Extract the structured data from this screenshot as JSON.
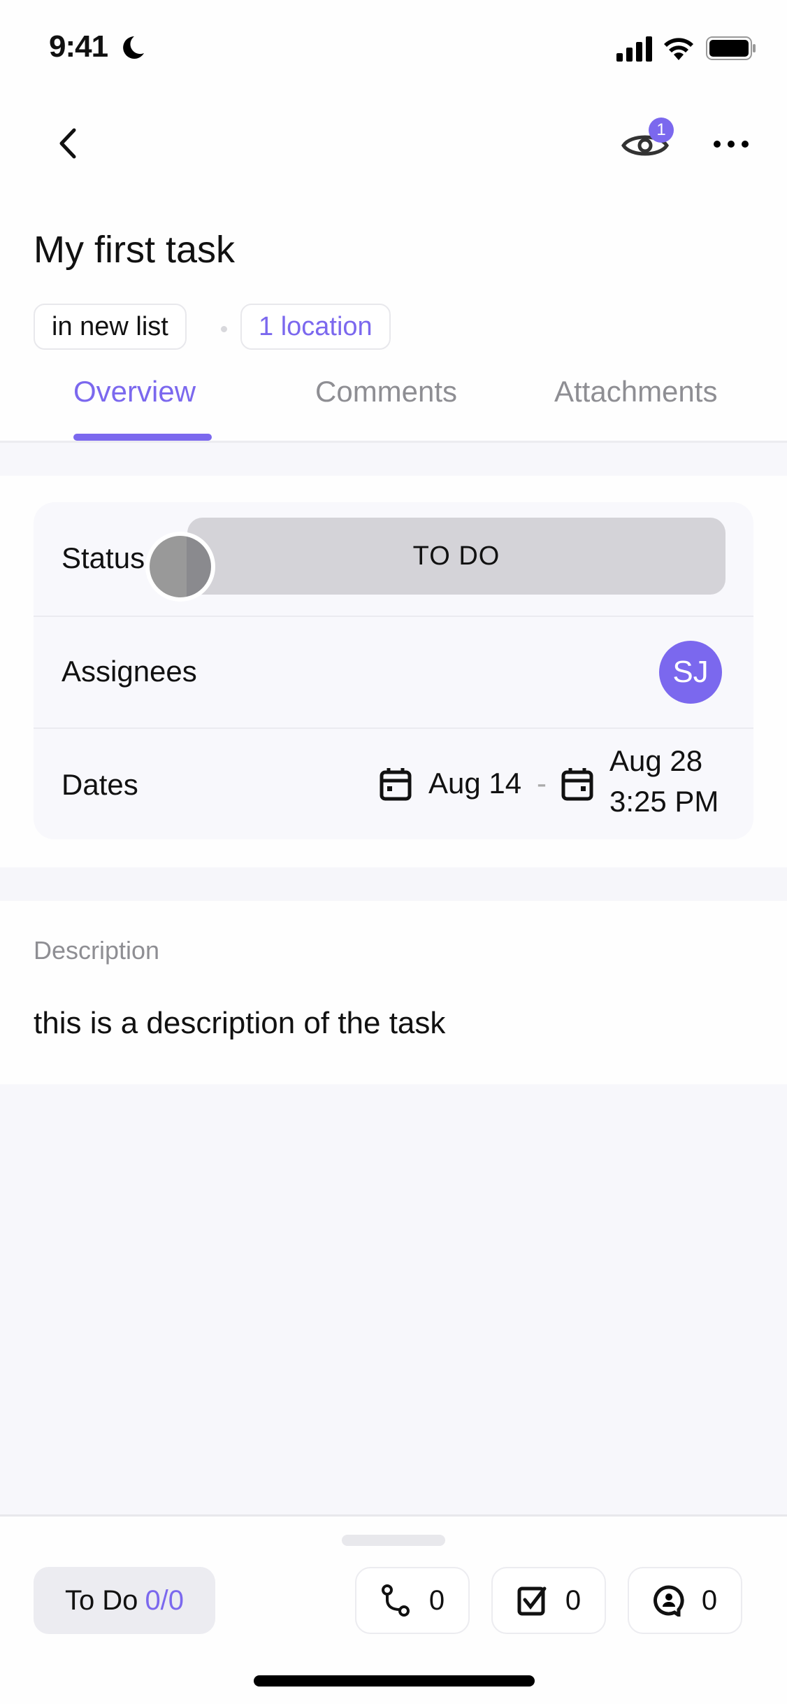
{
  "status_bar": {
    "time": "9:41"
  },
  "nav": {
    "watchers_badge": "1"
  },
  "task": {
    "title": "My first task",
    "list_chip": "in new list",
    "location_chip": "1 location"
  },
  "tabs": [
    {
      "label": "Overview",
      "active": true
    },
    {
      "label": "Comments",
      "active": false
    },
    {
      "label": "Attachments",
      "active": false
    }
  ],
  "fields": {
    "status_label": "Status",
    "status_value": "TO DO",
    "assignees_label": "Assignees",
    "assignee_initials": "SJ",
    "dates_label": "Dates",
    "start_date": "Aug 14",
    "date_separator": "-",
    "due_date": "Aug 28",
    "due_time": "3:25 PM"
  },
  "description": {
    "label": "Description",
    "text": "this is a description of the task"
  },
  "bottom_bar": {
    "status_label": "To Do",
    "checklist_count": "0/0",
    "dependencies_count": "0",
    "checklists_count": "0",
    "assigned_comments_count": "0"
  },
  "colors": {
    "accent": "#7b68ee",
    "status_pill": "#d4d3d8"
  }
}
